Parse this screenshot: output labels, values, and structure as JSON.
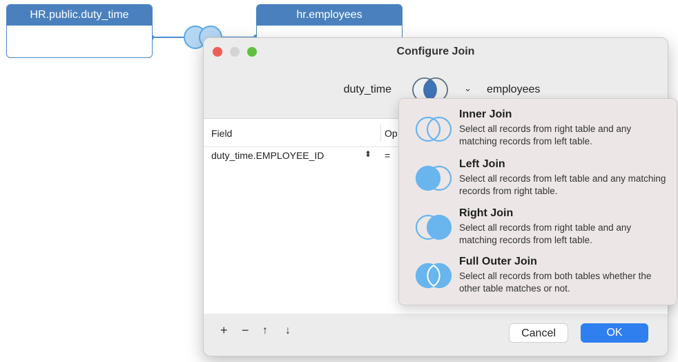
{
  "canvas": {
    "table_left": {
      "name": "HR.public.duty_time"
    },
    "table_right": {
      "name": "hr.employees"
    }
  },
  "dialog": {
    "title": "Configure Join",
    "left_table": "duty_time",
    "right_table": "employees",
    "join_chevron": "⌄",
    "columns": {
      "field": "Field",
      "operator": "Op"
    },
    "rows": [
      {
        "field": "duty_time.EMPLOYEE_ID",
        "stepper": "⬍",
        "operator": "="
      }
    ],
    "toolbar": {
      "add": "+",
      "remove": "−",
      "up": "↑",
      "down": "↓"
    },
    "cancel_label": "Cancel",
    "ok_label": "OK"
  },
  "join_menu": {
    "options": [
      {
        "title": "Inner Join",
        "desc": "Select all records from right table and any matching records from left table.",
        "icon": "inner-join-icon"
      },
      {
        "title": "Left Join",
        "desc": "Select all records from left table and any matching records from right table.",
        "icon": "left-join-icon"
      },
      {
        "title": "Right Join",
        "desc": "Select all records from right table and any matching records from left table.",
        "icon": "right-join-icon"
      },
      {
        "title": "Full Outer Join",
        "desc": "Select all records from both tables whether the other table matches or not.",
        "icon": "full-outer-join-icon"
      }
    ]
  },
  "colors": {
    "accent": "#2f7fef",
    "node_header": "#4a80bd",
    "venn_fill": "#69b5ee",
    "venn_stroke": "#5aa9e6"
  }
}
